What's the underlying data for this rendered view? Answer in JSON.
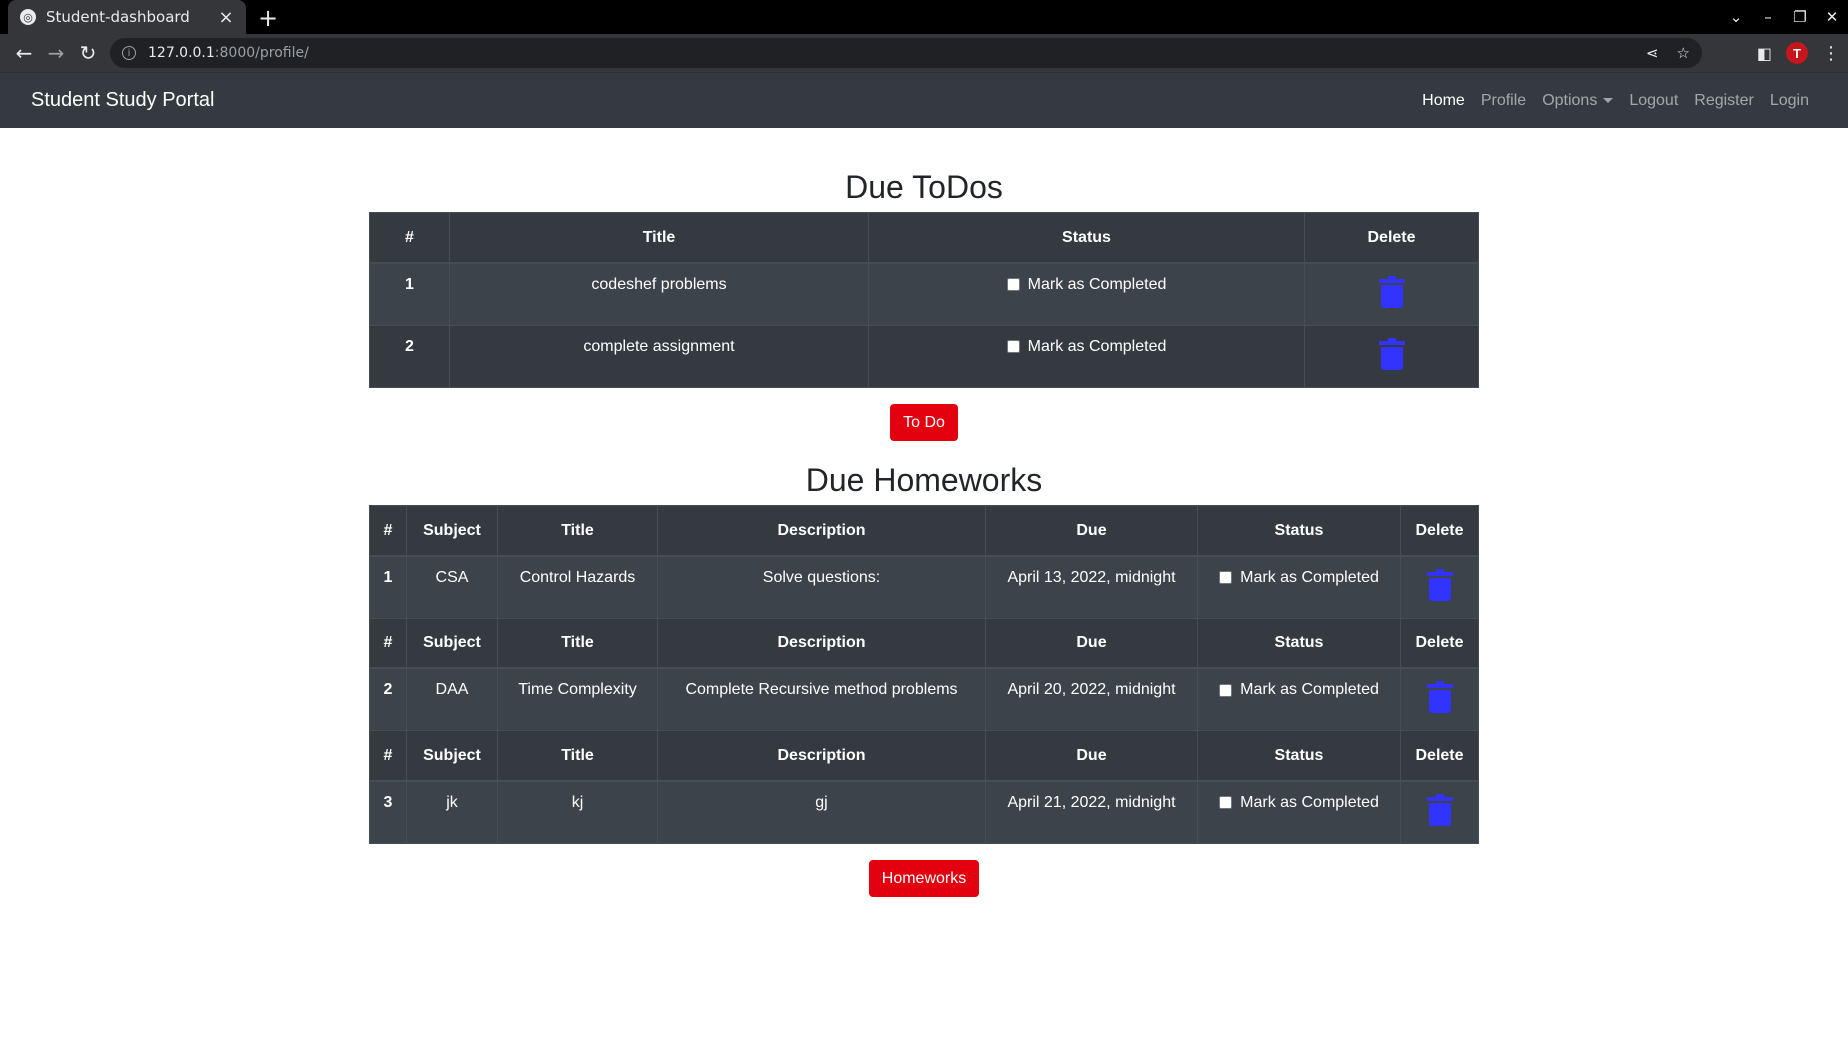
{
  "browser": {
    "tab_title": "Student-dashboard",
    "url_host": "127.0.0.1",
    "url_path": ":8000/profile/"
  },
  "navbar": {
    "brand": "Student Study Portal",
    "links": {
      "home": "Home",
      "profile": "Profile",
      "options": "Options",
      "logout": "Logout",
      "register": "Register",
      "login": "Login"
    }
  },
  "todos": {
    "heading": "Due ToDos",
    "headers": {
      "num": "#",
      "title": "Title",
      "status": "Status",
      "delete": "Delete"
    },
    "rows": [
      {
        "num": "1",
        "title": "codeshef problems",
        "status": "Mark as Completed"
      },
      {
        "num": "2",
        "title": "complete assignment",
        "status": "Mark as Completed"
      }
    ],
    "button": "To Do"
  },
  "homeworks": {
    "heading": "Due Homeworks",
    "headers": {
      "num": "#",
      "subject": "Subject",
      "title": "Title",
      "description": "Description",
      "due": "Due",
      "status": "Status",
      "delete": "Delete"
    },
    "rows": [
      {
        "num": "1",
        "subject": "CSA",
        "title": "Control Hazards",
        "description": "Solve questions:",
        "due": "April 13, 2022, midnight",
        "status": "Mark as Completed"
      },
      {
        "num": "2",
        "subject": "DAA",
        "title": "Time Complexity",
        "description": "Complete Recursive method problems",
        "due": "April 20, 2022, midnight",
        "status": "Mark as Completed"
      },
      {
        "num": "3",
        "subject": "jk",
        "title": "kj",
        "description": "gj",
        "due": "April 21, 2022, midnight",
        "status": "Mark as Completed"
      }
    ],
    "button": "Homeworks"
  },
  "colors": {
    "navbar_bg": "#343a40",
    "table_bg": "#343a40",
    "button_red": "#e3000f",
    "trash_blue": "#3333ff"
  }
}
